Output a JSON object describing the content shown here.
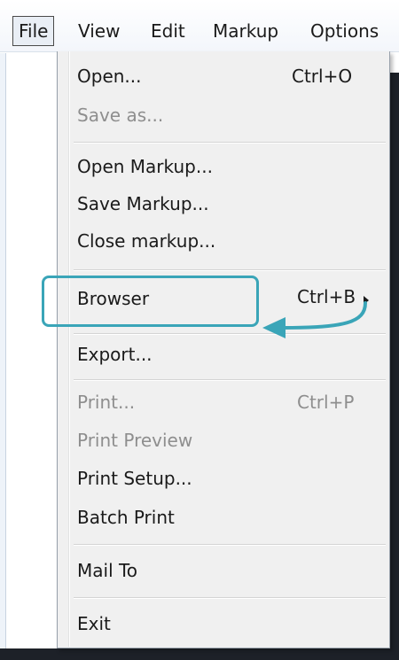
{
  "menubar": {
    "items": [
      {
        "label": "File",
        "active": true
      },
      {
        "label": "View"
      },
      {
        "label": "Edit"
      },
      {
        "label": "Markup"
      },
      {
        "label": "Options"
      }
    ]
  },
  "file_menu": {
    "open": {
      "label": "Open...",
      "shortcut": "Ctrl+O"
    },
    "save_as": {
      "label": "Save as..."
    },
    "open_markup": {
      "label": "Open Markup..."
    },
    "save_markup": {
      "label": "Save Markup..."
    },
    "close_markup": {
      "label": "Close markup..."
    },
    "browser": {
      "label": "Browser",
      "shortcut": "Ctrl+B"
    },
    "export": {
      "label": "Export..."
    },
    "print": {
      "label": "Print...",
      "shortcut": "Ctrl+P"
    },
    "print_preview": {
      "label": "Print Preview"
    },
    "print_setup": {
      "label": "Print Setup..."
    },
    "batch_print": {
      "label": "Batch Print"
    },
    "mail_to": {
      "label": "Mail To"
    },
    "exit": {
      "label": "Exit"
    }
  },
  "colors": {
    "annotation": "#3aa5b8",
    "disabled_text": "#8e8e8e",
    "menu_background": "#f0f0f0"
  },
  "icons": {
    "submenu_arrow": "chevron-right-icon",
    "callout_arrow": "curved-arrow-icon"
  }
}
